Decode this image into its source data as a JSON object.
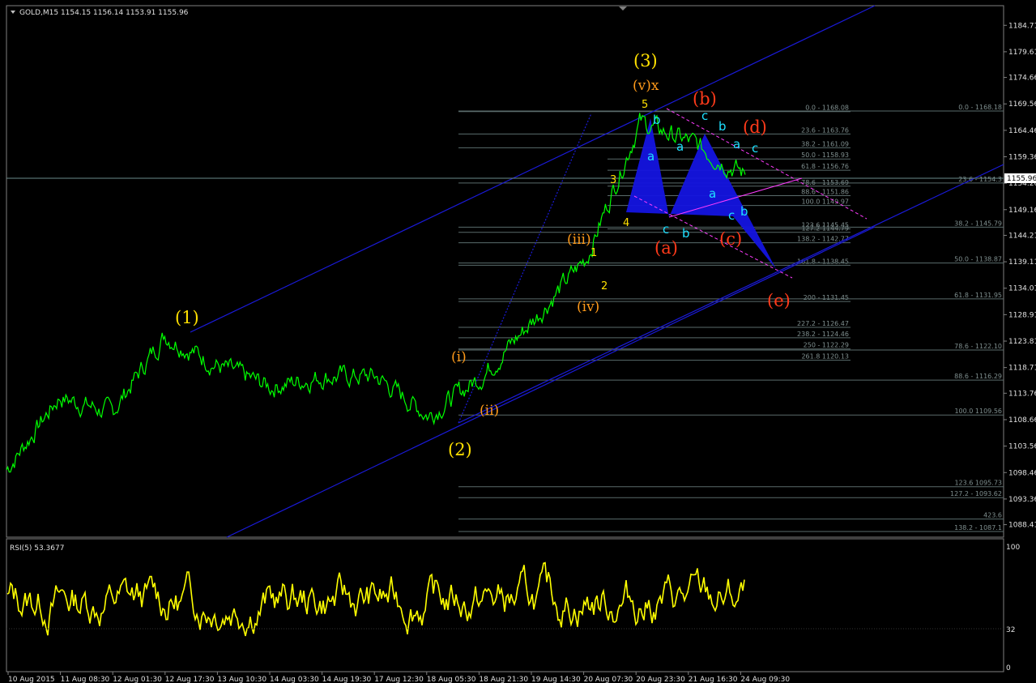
{
  "header": {
    "symbol_label": "GOLD,M15  1154.15 1156.14 1153.91 1155.96"
  },
  "price_axis": {
    "ticks": [
      "1184.71",
      "1179.61",
      "1174.66",
      "1169.56",
      "1164.46",
      "1159.36",
      "1154.26",
      "1149.16",
      "1144.21",
      "1139.11",
      "1134.01",
      "1128.91",
      "1123.81",
      "1118.71",
      "1113.76",
      "1108.66",
      "1103.56",
      "1098.46",
      "1093.36",
      "1088.41"
    ],
    "current_price": "1155.96"
  },
  "rsi": {
    "label": "RSI(5) 53.3677",
    "ticks": [
      "100",
      "32",
      "0"
    ]
  },
  "time_axis": {
    "labels": [
      "10 Aug 2015",
      "11 Aug 08:30",
      "12 Aug 01:30",
      "12 Aug 17:30",
      "13 Aug 10:30",
      "14 Aug 03:30",
      "14 Aug 19:30",
      "17 Aug 12:30",
      "18 Aug 05:30",
      "18 Aug 21:30",
      "19 Aug 14:30",
      "20 Aug 07:30",
      "20 Aug 23:30",
      "21 Aug 16:30",
      "24 Aug 09:30"
    ]
  },
  "fib_right": [
    "0.0 - 1168.18",
    "23.6 - 1154.3",
    "38.2 - 1145.79",
    "50.0 - 1138.87",
    "61.8 - 1131.95",
    "78.6 - 1122.10",
    "88.6 - 1116.29",
    "100.0 1109.56",
    "123.6 1095.73",
    "127.2 - 1093.62",
    "423.6",
    "138.2 - 1087.1"
  ],
  "fib_mid": [
    "0.0 - 1168.08",
    "23.6 - 1163.76",
    "38.2 - 1161.09",
    "50.0 - 1158.93",
    "61.8 - 1156.76",
    "78.6 - 1153.69",
    "88.6 - 1151.86",
    "100.0 1149.97",
    "123.6 1145.45",
    "127.2 1144.79",
    "138.2 - 1142.77",
    "161.8 - 1138.45",
    "200 - 1131.45",
    "227.2 - 1126.47",
    "238.2 - 1124.46",
    "250 - 1122.29",
    "261.8 1120.13"
  ],
  "wave_labels": {
    "w1": "(1)",
    "w2": "(2)",
    "w3": "(3)",
    "wi": "(i)",
    "wii": "(ii)",
    "wiii": "(iii)",
    "wiv": "(iv)",
    "wvx": "(v)x",
    "n1": "1",
    "n2": "2",
    "n3": "3",
    "n4": "4",
    "n5": "5",
    "ua": "(a)",
    "ub": "(b)",
    "uc": "(c)",
    "ud": "(d)",
    "ue": "(e)",
    "sa1": "a",
    "sb1": "b",
    "sc1": "c",
    "sa2": "a",
    "sb2": "b",
    "sc2": "c",
    "sa3": "a",
    "sb3": "b",
    "sc3": "c",
    "sa4": "a",
    "sb4": "b",
    "sc4": "c",
    "sc5": "c"
  },
  "chart_data": {
    "type": "line",
    "symbol": "GOLD",
    "timeframe": "M15",
    "ohlc_last": {
      "open": 1154.15,
      "high": 1156.14,
      "low": 1153.91,
      "close": 1155.96
    },
    "ylim": [
      1086.0,
      1188.5
    ],
    "x": [
      "10 Aug 2015",
      "11 Aug 08:30",
      "12 Aug 01:30",
      "12 Aug 17:30",
      "13 Aug 10:30",
      "14 Aug 03:30",
      "14 Aug 19:30",
      "17 Aug 12:30",
      "18 Aug 05:30",
      "18 Aug 21:30",
      "19 Aug 14:30",
      "20 Aug 07:30",
      "20 Aug 23:30",
      "21 Aug 16:30",
      "24 Aug 09:30"
    ],
    "series": [
      {
        "values": [
          1099.0,
          1113.0,
          1110.0,
          1125.0,
          1119.0,
          1115.0,
          1117.0,
          1117.0,
          1109.5,
          1117.0,
          1128.0,
          1140.0,
          1166.0,
          1162.0,
          1155.9
        ]
      }
    ],
    "rsi": {
      "label": "RSI(5) 53.3677",
      "ylim": [
        0,
        100
      ],
      "last": 53.3677,
      "level": 32
    },
    "colors": {
      "price": "#00ff00",
      "rsi": "#ffff00",
      "channel": "#1a1ad8",
      "triangle": "#1414e0",
      "fib": "#5a6b6b"
    }
  }
}
